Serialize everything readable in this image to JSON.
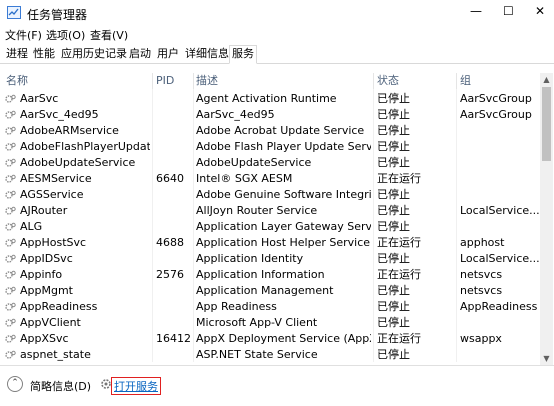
{
  "window": {
    "title": "任务管理器",
    "minimize": "—",
    "maximize": "☐",
    "close": "✕"
  },
  "menu": [
    "文件(F)",
    "选项(O)",
    "查看(V)"
  ],
  "tabs": [
    "进程",
    "性能",
    "应用历史记录",
    "启动",
    "用户",
    "详细信息",
    "服务"
  ],
  "active_tab": "服务",
  "columns": {
    "name": "名称",
    "pid": "PID",
    "description": "描述",
    "status": "状态",
    "group": "组"
  },
  "services": [
    {
      "name": "AarSvc",
      "pid": "",
      "description": "Agent Activation Runtime",
      "status": "已停止",
      "group": "AarSvcGroup"
    },
    {
      "name": "AarSvc_4ed95",
      "pid": "",
      "description": "AarSvc_4ed95",
      "status": "已停止",
      "group": "AarSvcGroup"
    },
    {
      "name": "AdobeARMservice",
      "pid": "",
      "description": "Adobe Acrobat Update Service",
      "status": "已停止",
      "group": ""
    },
    {
      "name": "AdobeFlashPlayerUpdat...",
      "pid": "",
      "description": "Adobe Flash Player Update Service",
      "status": "已停止",
      "group": ""
    },
    {
      "name": "AdobeUpdateService",
      "pid": "",
      "description": "AdobeUpdateService",
      "status": "已停止",
      "group": ""
    },
    {
      "name": "AESMService",
      "pid": "6640",
      "description": "Intel® SGX AESM",
      "status": "正在运行",
      "group": ""
    },
    {
      "name": "AGSService",
      "pid": "",
      "description": "Adobe Genuine Software Integrit...",
      "status": "已停止",
      "group": ""
    },
    {
      "name": "AJRouter",
      "pid": "",
      "description": "AllJoyn Router Service",
      "status": "已停止",
      "group": "LocalService..."
    },
    {
      "name": "ALG",
      "pid": "",
      "description": "Application Layer Gateway Service",
      "status": "已停止",
      "group": ""
    },
    {
      "name": "AppHostSvc",
      "pid": "4688",
      "description": "Application Host Helper Service",
      "status": "正在运行",
      "group": "apphost"
    },
    {
      "name": "AppIDSvc",
      "pid": "",
      "description": "Application Identity",
      "status": "已停止",
      "group": "LocalService..."
    },
    {
      "name": "Appinfo",
      "pid": "2576",
      "description": "Application Information",
      "status": "正在运行",
      "group": "netsvcs"
    },
    {
      "name": "AppMgmt",
      "pid": "",
      "description": "Application Management",
      "status": "已停止",
      "group": "netsvcs"
    },
    {
      "name": "AppReadiness",
      "pid": "",
      "description": "App Readiness",
      "status": "已停止",
      "group": "AppReadiness"
    },
    {
      "name": "AppVClient",
      "pid": "",
      "description": "Microsoft App-V Client",
      "status": "已停止",
      "group": ""
    },
    {
      "name": "AppXSvc",
      "pid": "16412",
      "description": "AppX Deployment Service (AppX...",
      "status": "正在运行",
      "group": "wsappx"
    },
    {
      "name": "aspnet_state",
      "pid": "",
      "description": "ASP.NET State Service",
      "status": "已停止",
      "group": ""
    }
  ],
  "footer": {
    "collapse_icon": "chevron-up-icon",
    "fewer_details": "简略信息(D)",
    "open_services": "打开服务"
  },
  "colors": {
    "header_text": "#4c607a",
    "link": "#0a66c2",
    "highlight_box": "#e02020"
  }
}
